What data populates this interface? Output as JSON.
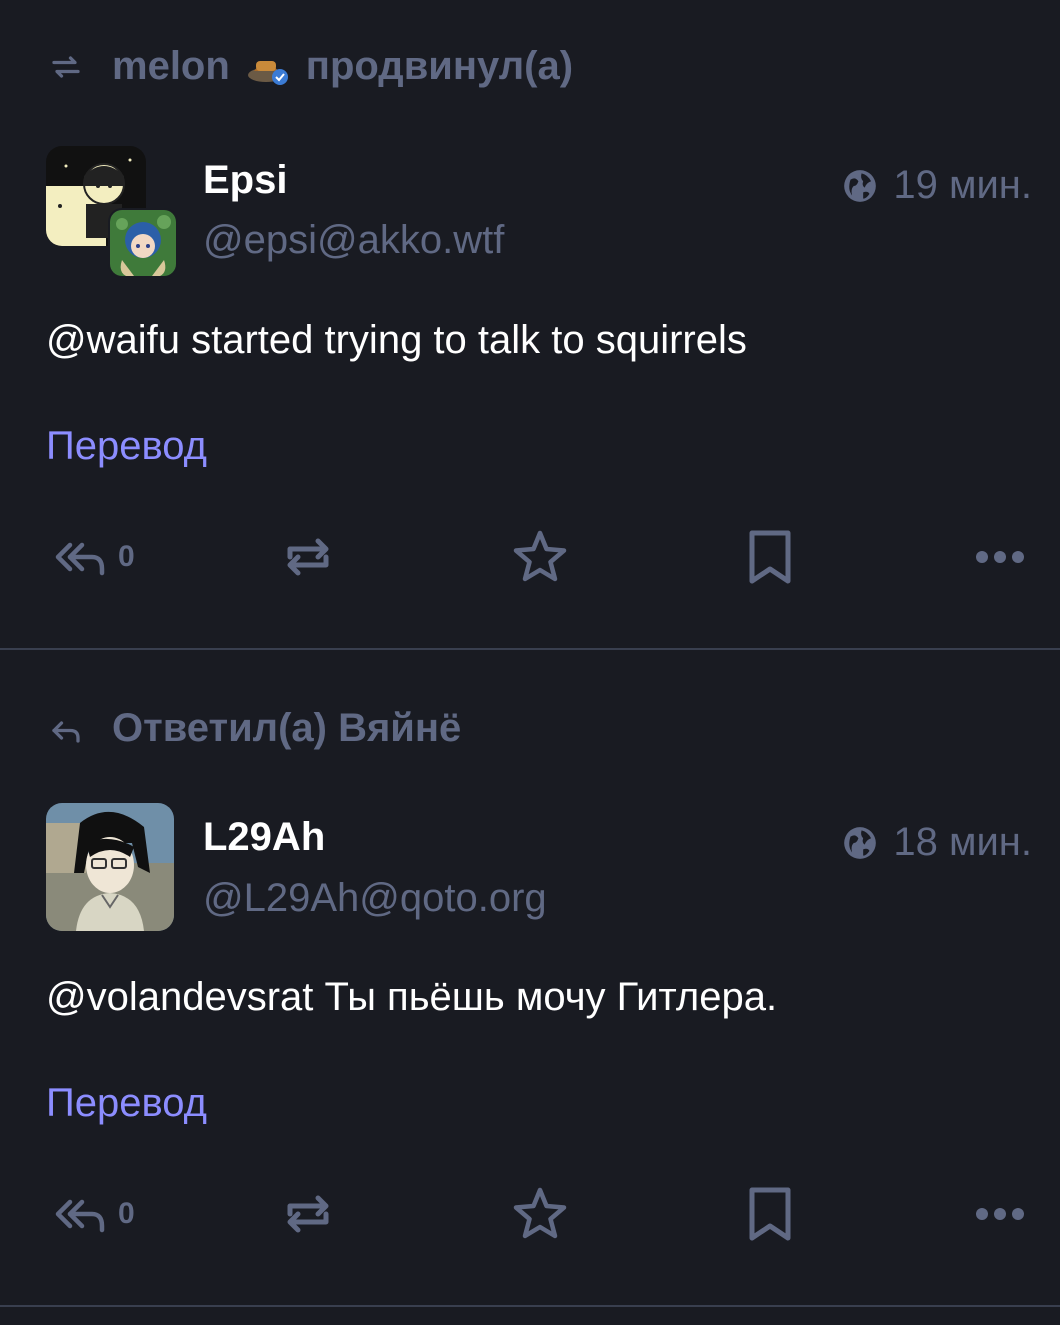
{
  "posts": [
    {
      "context": {
        "icon": "boost-icon",
        "user": "melon",
        "action": "продвинул(а)"
      },
      "display_name": "Epsi",
      "acct": "@epsi@akko.wtf",
      "time": "19 мин.",
      "content": "@waifu started trying to talk to squirrels",
      "translate": "Перевод",
      "reply_count": "0"
    },
    {
      "context": {
        "icon": "reply-icon",
        "text": "Ответил(а) Вяйнё"
      },
      "display_name": "L29Ah",
      "acct": "@L29Ah@qoto.org",
      "time": "18 мин.",
      "content": "@volandevsrat Ты пьёшь мочу Гитлера.",
      "translate": "Перевод",
      "reply_count": "0"
    }
  ],
  "colors": {
    "background": "#191b22",
    "muted": "#606984",
    "link": "#8c8dff",
    "text": "#ffffff"
  }
}
